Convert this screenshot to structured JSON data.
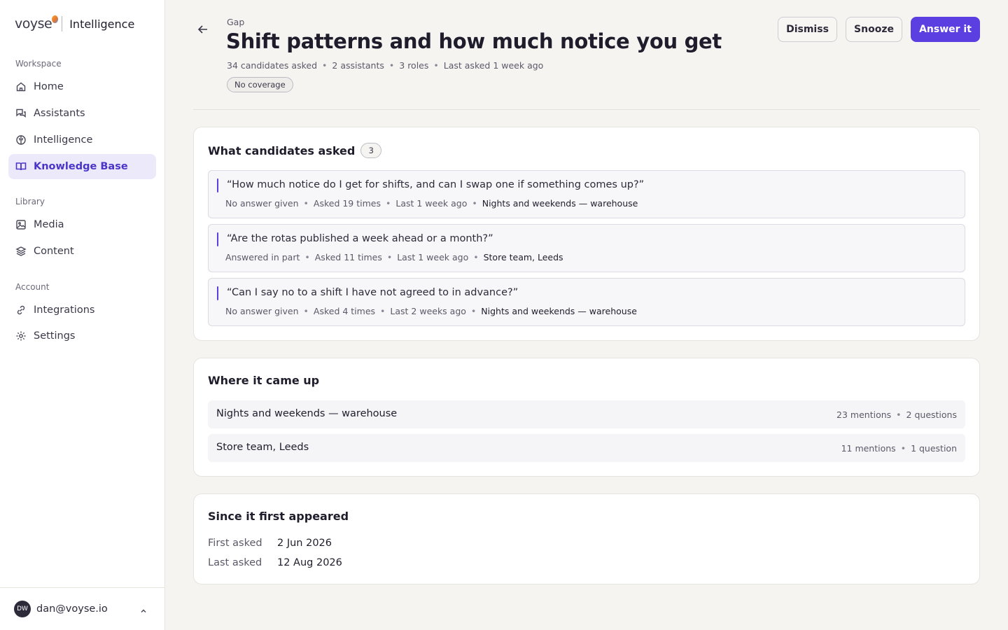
{
  "brand": {
    "logo": "voyse",
    "product": "Intelligence"
  },
  "sidebar": {
    "sections": [
      "Workspace",
      "Library",
      "Account"
    ],
    "items": [
      {
        "label": "Home",
        "icon": "home-icon"
      },
      {
        "label": "Assistants",
        "icon": "chat-icon"
      },
      {
        "label": "Intelligence",
        "icon": "brain-icon"
      },
      {
        "label": "Knowledge Base",
        "icon": "book-icon",
        "active": true
      },
      {
        "label": "Media",
        "icon": "image-icon"
      },
      {
        "label": "Content",
        "icon": "layers-icon"
      },
      {
        "label": "Integrations",
        "icon": "link-icon"
      },
      {
        "label": "Settings",
        "icon": "gear-icon"
      }
    ]
  },
  "user": {
    "initials": "DW",
    "email": "dan@voyse.io"
  },
  "header": {
    "eyebrow": "Gap",
    "title": "Shift patterns and how much notice you get",
    "meta": [
      "34 candidates asked",
      "2 assistants",
      "3 roles",
      "Last asked 1 week ago"
    ],
    "status_pill": "No coverage",
    "actions": {
      "dismiss": "Dismiss",
      "snooze": "Snooze",
      "answer": "Answer it"
    }
  },
  "questions_card": {
    "title": "What candidates asked",
    "count": "3",
    "items": [
      {
        "text": "“How much notice do I get for shifts, and can I swap one if something comes up?”",
        "status": "No answer given",
        "asked": "Asked 19 times",
        "last": "Last 1 week ago",
        "role": "Nights and weekends — warehouse"
      },
      {
        "text": "“Are the rotas published a week ahead or a month?”",
        "status": "Answered in part",
        "asked": "Asked 11 times",
        "last": "Last 1 week ago",
        "role": "Store team, Leeds"
      },
      {
        "text": "“Can I say no to a shift I have not agreed to in advance?”",
        "status": "No answer given",
        "asked": "Asked 4 times",
        "last": "Last 2 weeks ago",
        "role": "Nights and weekends — warehouse"
      }
    ]
  },
  "places_card": {
    "title": "Where it came up",
    "items": [
      {
        "name": "Nights and weekends — warehouse",
        "mentions": "23 mentions",
        "questions": "2 questions"
      },
      {
        "name": "Store team, Leeds",
        "mentions": "11 mentions",
        "questions": "1 question"
      }
    ]
  },
  "timeline_card": {
    "title": "Since it first appeared",
    "first_label": "First asked",
    "first_value": "2 Jun 2026",
    "last_label": "Last asked",
    "last_value": "12 Aug 2026"
  },
  "colors": {
    "accent": "#5b3fe0",
    "active_bg": "#ece9fb",
    "page_bg": "#f5f4f1"
  }
}
